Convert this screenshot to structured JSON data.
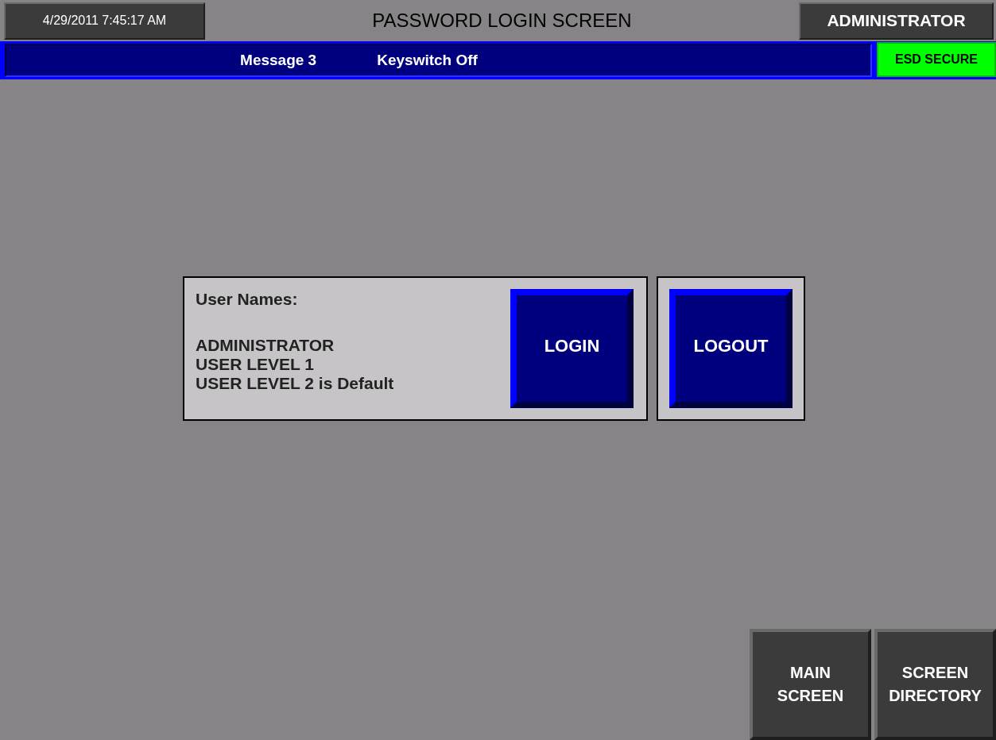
{
  "header": {
    "datetime": "4/29/2011 7:45:17 AM",
    "title": "PASSWORD LOGIN SCREEN",
    "current_user": "ADMINISTRATOR"
  },
  "message_bar": {
    "messages": [
      "Message 3",
      "Keyswitch Off"
    ],
    "status": "ESD SECURE"
  },
  "user_panel": {
    "heading": "User Names:",
    "users": [
      "ADMINISTRATOR",
      "USER LEVEL 1",
      "USER LEVEL 2 is Default"
    ]
  },
  "actions": [
    "LOGIN",
    "LOGOUT"
  ],
  "nav_buttons": [
    {
      "lines": [
        "MAIN",
        "SCREEN"
      ]
    },
    {
      "lines": [
        "SCREEN",
        "DIRECTORY"
      ]
    }
  ]
}
